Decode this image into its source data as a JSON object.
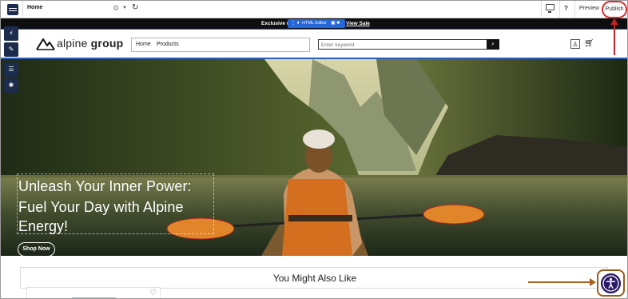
{
  "editor": {
    "page_name": "Home",
    "gear_icon": "gear-icon",
    "refresh_icon": "refresh-icon",
    "preview_label": "Preview",
    "publish_label": "Publish",
    "help_label": "?",
    "tools": [
      "bolt-icon",
      "pencil-icon",
      "list-icon",
      "settings-icon"
    ]
  },
  "announcement": {
    "text": "Exclusive w",
    "link": "View Sale",
    "chip_label": "HTML Editor"
  },
  "site": {
    "logo_light": "alpine",
    "logo_bold": " group",
    "nav": [
      "Home",
      "Products"
    ],
    "search_placeholder": "Enter keyword"
  },
  "hero": {
    "line1": "Unleash Your Inner Power:",
    "line2": "Fuel Your Day with Alpine",
    "line3": "Energy!",
    "button": "Shop Now"
  },
  "section": {
    "title": "You Might Also Like"
  },
  "colors": {
    "navy": "#1c2c4c",
    "publish_ring": "#d92b2b",
    "accent_blue": "#2a5fb8",
    "a11y": "#2a1a68",
    "annotation_arrow": "#a4631e"
  }
}
